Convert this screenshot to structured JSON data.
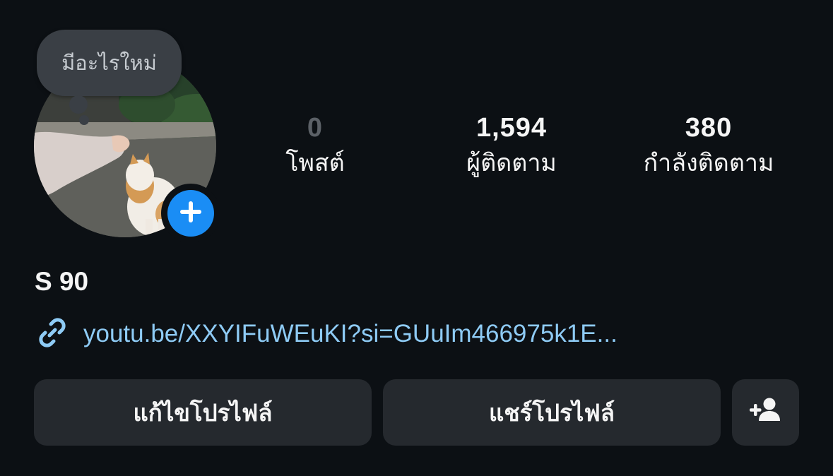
{
  "profile": {
    "note": "มีอะไรใหม่",
    "display_name": "S 90",
    "link": "youtu.be/XXYIFuWEuKI?si=GUuIm466975k1E..."
  },
  "stats": {
    "posts_count": "0",
    "posts_label": "โพสต์",
    "followers_count": "1,594",
    "followers_label": "ผู้ติดตาม",
    "following_count": "380",
    "following_label": "กำลังติดตาม"
  },
  "buttons": {
    "edit_profile": "แก้ไขโปรไฟล์",
    "share_profile": "แชร์โปรไฟล์"
  },
  "icons": {
    "add_story": "plus-icon",
    "link": "link-icon",
    "add_person": "add-person-icon"
  },
  "colors": {
    "background": "#0c1014",
    "button": "#25292e",
    "link": "#8ecbf5",
    "accent": "#1a8df5"
  }
}
